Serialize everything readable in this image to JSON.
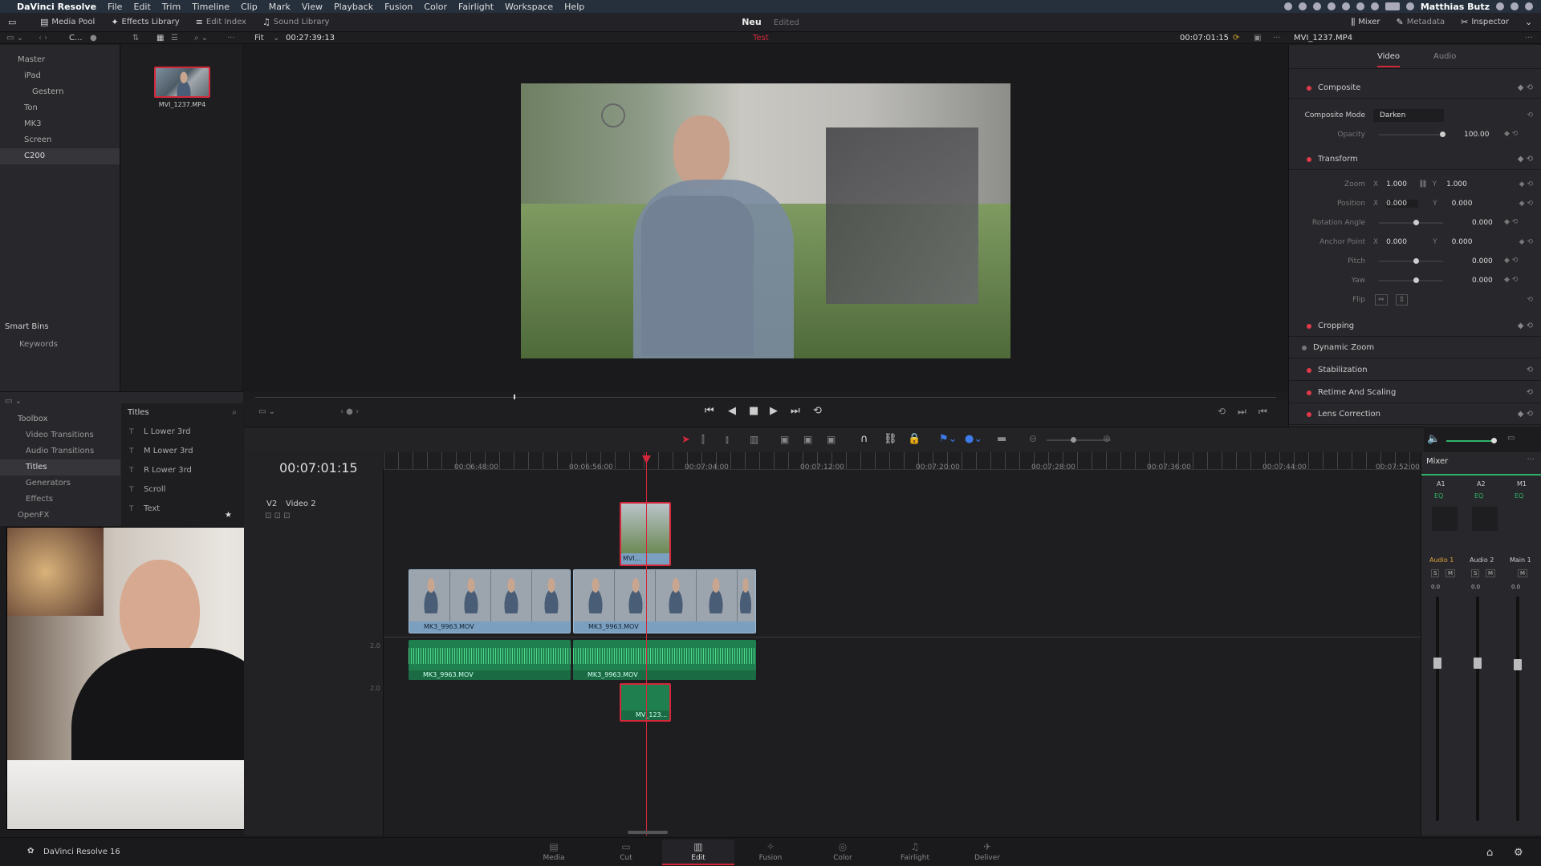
{
  "menubar": {
    "app": "DaVinci Resolve",
    "items": [
      "File",
      "Edit",
      "Trim",
      "Timeline",
      "Clip",
      "Mark",
      "View",
      "Playback",
      "Fusion",
      "Color",
      "Fairlight",
      "Workspace",
      "Help"
    ],
    "user": "Matthias Butz"
  },
  "toolbar": {
    "media_pool": "Media Pool",
    "effects_library": "Effects Library",
    "edit_index": "Edit Index",
    "sound_library": "Sound Library",
    "mixer": "Mixer",
    "metadata": "Metadata",
    "inspector": "Inspector"
  },
  "project": {
    "name": "Neu",
    "status": "Edited"
  },
  "viewerbar": {
    "bin_short": "C...",
    "fit": "Fit",
    "source_tc": "00:27:39:13",
    "timeline_name": "Test",
    "record_tc": "00:07:01:15",
    "clip_name": "MVI_1237.MP4"
  },
  "bins": {
    "items": [
      "Master",
      "iPad",
      "Gestern",
      "Ton",
      "MK3",
      "Screen",
      "C200"
    ],
    "smart_bins": "Smart Bins",
    "keywords": "Keywords"
  },
  "media_clip": {
    "name": "MVI_1237.MP4"
  },
  "effects": {
    "toolbox": "Toolbox",
    "tree": [
      "Video Transitions",
      "Audio Transitions",
      "Titles",
      "Generators",
      "Effects",
      "OpenFX"
    ],
    "panel_title": "Titles",
    "titles": [
      "L Lower 3rd",
      "M Lower 3rd",
      "R Lower 3rd",
      "Scroll",
      "Text"
    ]
  },
  "timeline": {
    "timecode": "00:07:01:15",
    "ruler": [
      "00:06:48:00",
      "00:06:56:00",
      "00:07:04:00",
      "00:07:12:00",
      "00:07:20:00",
      "00:07:28:00",
      "00:07:36:00",
      "00:07:44:00",
      "00:07:52:00"
    ],
    "track_v2_id": "V2",
    "track_v2_name": "Video 2",
    "scale_marks": [
      "2.0",
      "2.0"
    ],
    "clips": {
      "v2": "MVI...",
      "v1a": "MK3_9963.MOV",
      "v1b": "MK3_9963.MOV",
      "a1a": "MK3_9963.MOV",
      "a1b": "MK3_9963.MOV",
      "a2": "MV_123..."
    }
  },
  "inspector": {
    "tabs": [
      "Video",
      "Audio"
    ],
    "composite": "Composite",
    "composite_mode_label": "Composite Mode",
    "composite_mode": "Darken",
    "opacity_label": "Opacity",
    "opacity": "100.00",
    "transform": "Transform",
    "zoom_label": "Zoom",
    "zoom_x": "1.000",
    "zoom_y": "1.000",
    "position_label": "Position",
    "pos_x": "0.000",
    "pos_y": "0.000",
    "rotation_label": "Rotation Angle",
    "rotation": "0.000",
    "anchor_label": "Anchor Point",
    "anchor_x": "0.000",
    "anchor_y": "0.000",
    "pitch_label": "Pitch",
    "pitch": "0.000",
    "yaw_label": "Yaw",
    "yaw": "0.000",
    "flip_label": "Flip",
    "x": "X",
    "y": "Y",
    "sections": [
      "Cropping",
      "Dynamic Zoom",
      "Stabilization",
      "Retime And Scaling",
      "Lens Correction"
    ]
  },
  "mixer": {
    "title": "Mixer",
    "channels": [
      "A1",
      "A2",
      "M1"
    ],
    "eq": "EQ",
    "strips": [
      "Audio 1",
      "Audio 2",
      "Main 1"
    ],
    "s": "S",
    "m": "M",
    "levels": [
      "0.0",
      "0.0",
      "0.0"
    ]
  },
  "pages": [
    "Media",
    "Cut",
    "Edit",
    "Fusion",
    "Color",
    "Fairlight",
    "Deliver"
  ],
  "footer": {
    "brand": "DaVinci Resolve 16"
  },
  "colors": {
    "accent_red": "#d4283a",
    "clip_blue": "#7b9fbf",
    "audio_green": "#1f7f4f"
  }
}
